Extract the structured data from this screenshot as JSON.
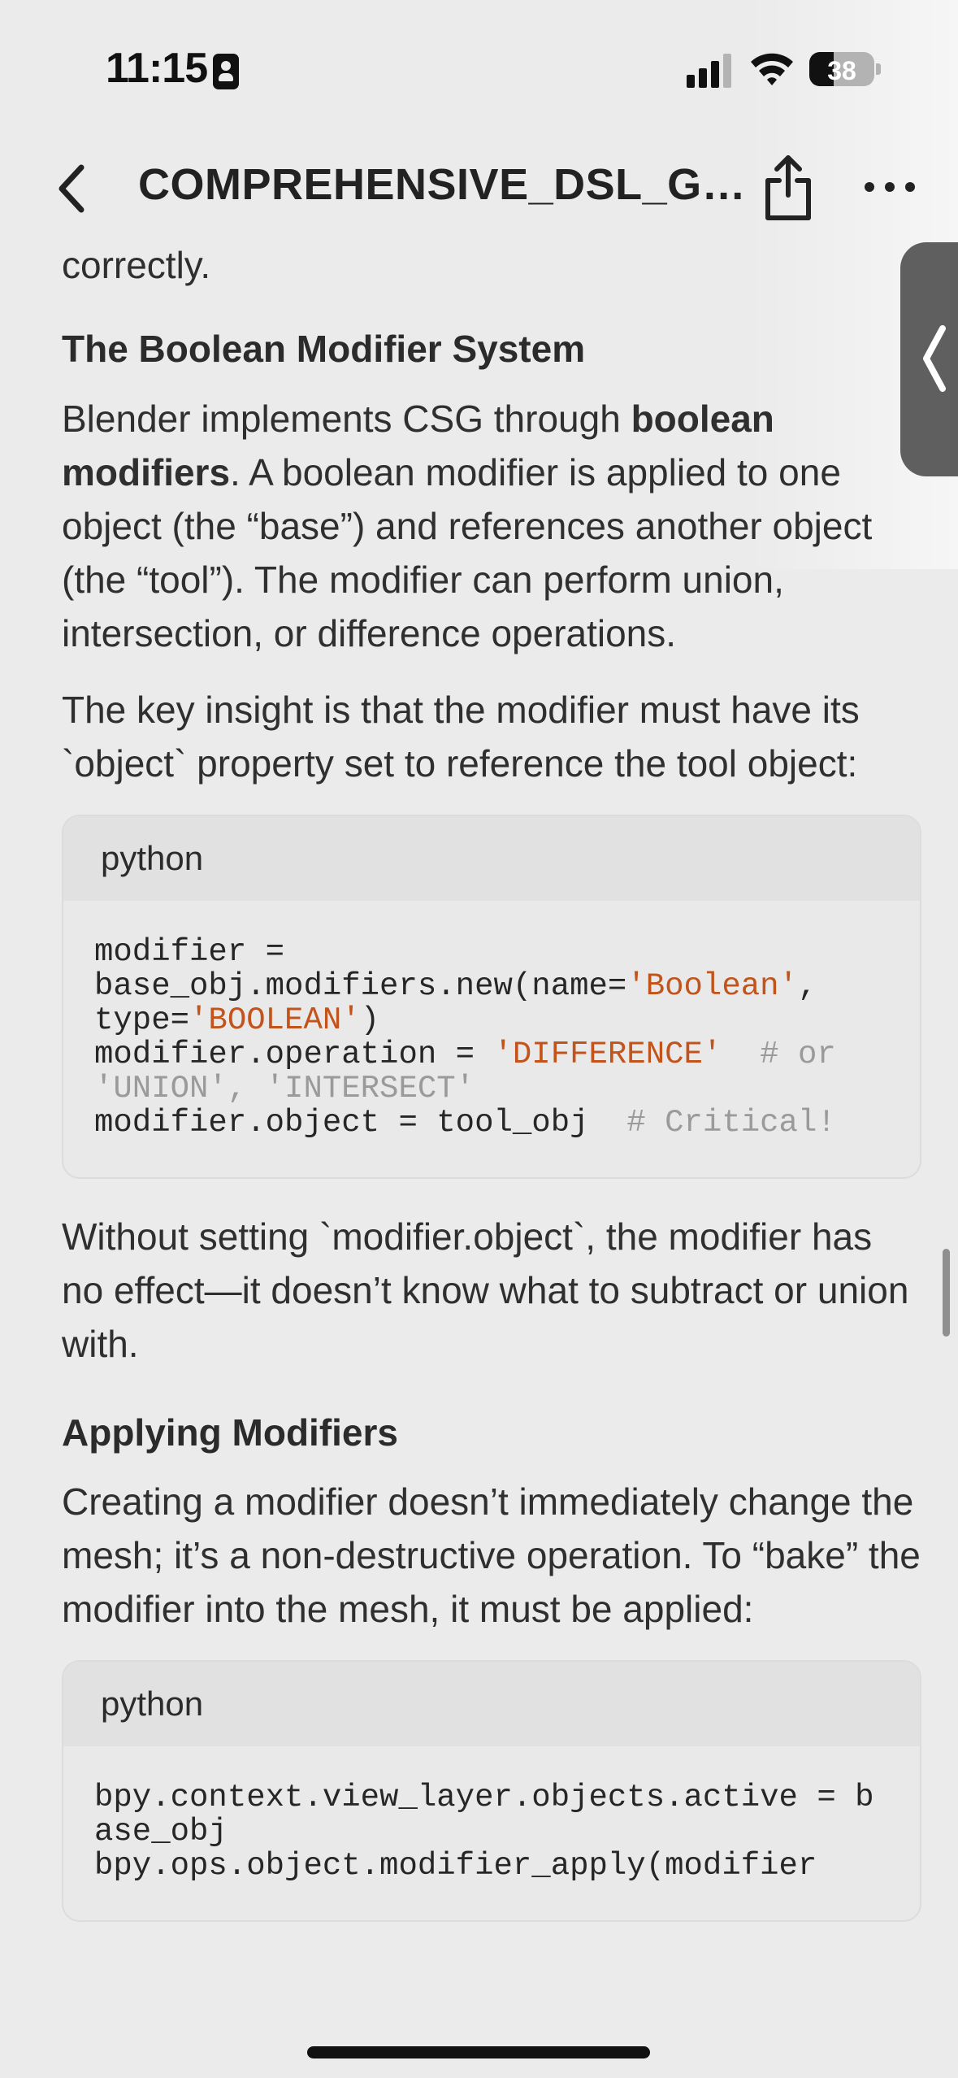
{
  "status_bar": {
    "time": "11:15",
    "battery_percent": "38",
    "battery_level": 0.38,
    "icons": [
      "contact-card-icon",
      "cellular-signal-icon",
      "wifi-icon",
      "battery-icon"
    ]
  },
  "nav": {
    "title": "COMPREHENSIVE_DSL_GU...",
    "icons": [
      "chevron-left-icon",
      "share-icon",
      "more-icon"
    ]
  },
  "side_tab": {
    "icon": "chevron-left-icon"
  },
  "content": {
    "fragment": "correctly.",
    "section1": {
      "heading": "The Boolean Modifier System",
      "p1_before": "Blender implements CSG through ",
      "p1_bold": "boolean modifiers",
      "p1_after": ". A boolean modifier is applied to one object (the “base”) and references another object (the “tool”). The modifier can perform union, intersection, or difference operations.",
      "p2": "The key insight is that the modifier must have its `object` property set to reference the tool object:",
      "code": {
        "language": "python",
        "l1a": "modifier =\nbase_obj.modifiers.new(name=",
        "l1s": "'Boolean'",
        "l1b": ",\ntype=",
        "l1s2": "'BOOLEAN'",
        "l1c": ")\nmodifier.operation = ",
        "l2s": "'DIFFERENCE'",
        "l2cm": "  # or 'UNION', 'INTERSECT'",
        "l3": "\nmodifier.object = tool_obj",
        "l3cm": "  # Critical!"
      },
      "p3": "Without setting `modifier.object`, the modifier has no effect—it doesn’t know what to subtract or union with."
    },
    "section2": {
      "heading": "Applying Modifiers",
      "p1": "Creating a modifier doesn’t immediately change the mesh; it’s a non-destructive operation. To “bake” the modifier into the mesh, it must be applied:",
      "code": {
        "language": "python",
        "text": "bpy.context.view_layer.objects.active = base_obj\nbpy.ops.object.modifier_apply(modifier"
      }
    }
  }
}
